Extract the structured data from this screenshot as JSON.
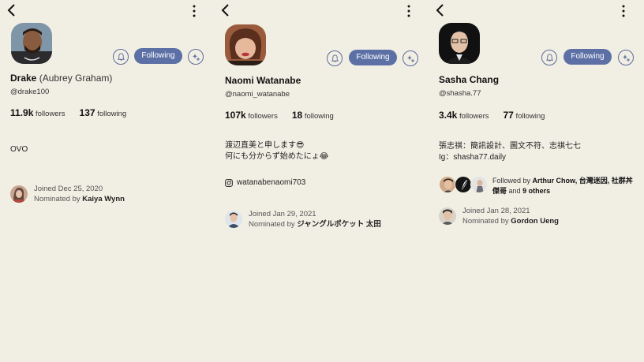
{
  "colors": {
    "background": "#f1efe4",
    "accent": "#5c70a6"
  },
  "profiles": [
    {
      "name": "Drake",
      "real_name": "(Aubrey Graham)",
      "handle": "@drake100",
      "followers_count": "11.9k",
      "followers_label": "followers",
      "following_count": "137",
      "following_label": "following",
      "follow_button": "Following",
      "bio_lines": [
        "OVO"
      ],
      "joined": "Joined Dec 25, 2020",
      "nominated_prefix": "Nominated by",
      "nominated_by": "Kaiya Wynn"
    },
    {
      "name": "Naomi Watanabe",
      "real_name": "",
      "handle": "@naomi_watanabe",
      "followers_count": "107k",
      "followers_label": "followers",
      "following_count": "18",
      "following_label": "following",
      "follow_button": "Following",
      "bio_lines": [
        "渡辺直美と申します😎",
        "何にも分からず始めたにょ😂"
      ],
      "instagram": "watanabenaomi703",
      "joined": "Joined Jan 29, 2021",
      "nominated_prefix": "Nominated by",
      "nominated_by": "ジャングルポケット 太田"
    },
    {
      "name": "Sasha Chang",
      "real_name": "",
      "handle": "@shasha.77",
      "followers_count": "3.4k",
      "followers_label": "followers",
      "following_count": "77",
      "following_label": "following",
      "follow_button": "Following",
      "bio_lines": [
        "張志祺：簡訊設計、圖文不符、志祺七七",
        "Ig：shasha77.daily"
      ],
      "followed_by_prefix": "Followed by",
      "followed_by_names": "Arthur Chow, 台灣迷因, 社群丼傑哥",
      "followed_by_and": "and",
      "followed_by_others": "9 others",
      "joined": "Joined Jan 28, 2021",
      "nominated_prefix": "Nominated by",
      "nominated_by": "Gordon Ueng"
    }
  ]
}
